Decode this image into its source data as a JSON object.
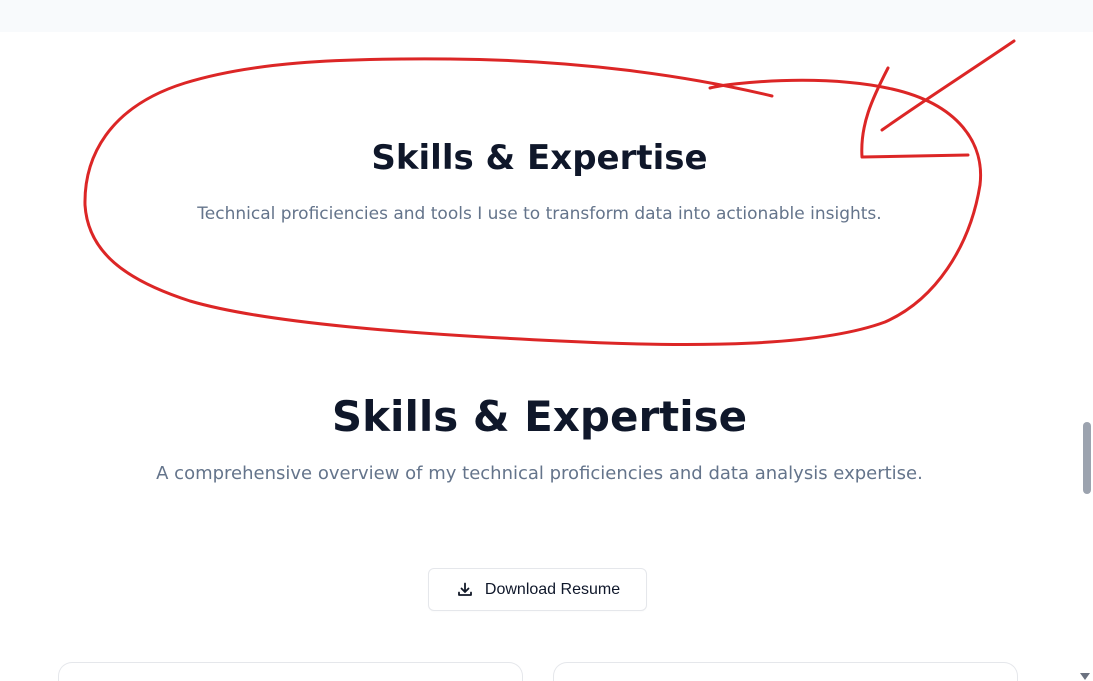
{
  "skills_header": {
    "title": "Skills & Expertise",
    "subtitle": "Technical proficiencies and tools I use to transform data into actionable insights."
  },
  "skills_section": {
    "title": "Skills & Expertise",
    "subtitle": "A comprehensive overview of my technical proficiencies and data analysis expertise.",
    "download_button": {
      "label": "Download Resume",
      "icon": "download-icon"
    }
  },
  "annotation": {
    "color": "#dc2626",
    "shapes": [
      "circle-highlight",
      "arrow"
    ]
  },
  "colors": {
    "heading": "#0f172a",
    "muted_text": "#64748b",
    "border": "#e5e7eb",
    "top_band": "#f8fafc"
  }
}
